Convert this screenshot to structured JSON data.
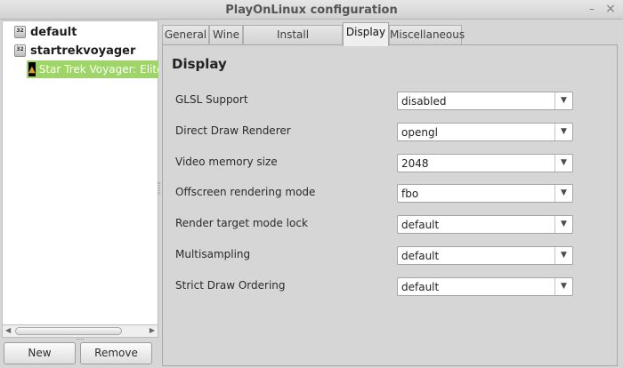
{
  "window": {
    "title": "PlayOnLinux configuration"
  },
  "tree": {
    "items": [
      {
        "label": "default",
        "icon": "32"
      },
      {
        "label": "startrekvoyager",
        "icon": "32"
      }
    ],
    "selected_child": {
      "label": "Star Trek Voyager:  Elite"
    }
  },
  "buttons": {
    "new": "New",
    "remove": "Remove"
  },
  "tabs": [
    {
      "label": "General"
    },
    {
      "label": "Wine"
    },
    {
      "label": "Install components"
    },
    {
      "label": "Display"
    },
    {
      "label": "Miscellaneous"
    }
  ],
  "display": {
    "title": "Display",
    "settings": [
      {
        "label": "GLSL Support",
        "value": "disabled"
      },
      {
        "label": "Direct Draw Renderer",
        "value": "opengl"
      },
      {
        "label": "Video memory size",
        "value": "2048"
      },
      {
        "label": "Offscreen rendering mode",
        "value": "fbo"
      },
      {
        "label": "Render target mode lock",
        "value": "default"
      },
      {
        "label": "Multisampling",
        "value": "default"
      },
      {
        "label": "Strict Draw Ordering",
        "value": "default"
      }
    ]
  },
  "colors": {
    "selection": "#9fd46b"
  }
}
